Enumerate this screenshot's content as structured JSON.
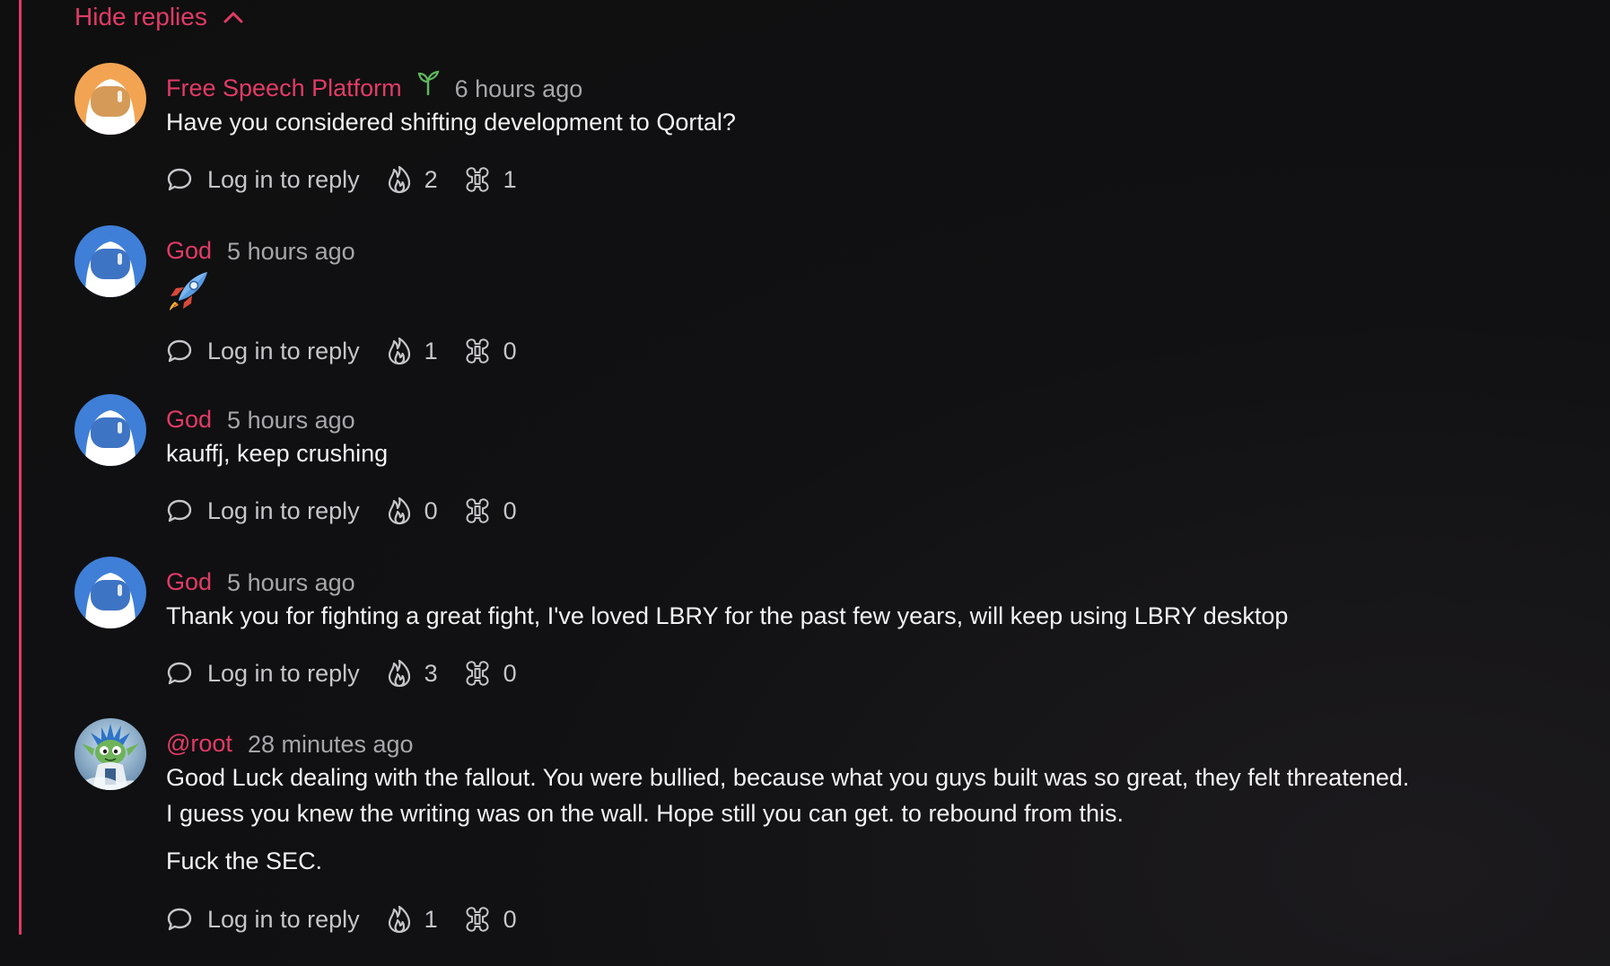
{
  "thread": {
    "hide_replies_label": "Hide replies",
    "accent_color": "#e23b66"
  },
  "comments": [
    {
      "author": "Free Speech Platform",
      "badge_icon": "sprout-icon",
      "time": "6 hours ago",
      "paragraphs": [
        "Have you considered shifting development to Qortal?"
      ],
      "reply_label": "Log in to reply",
      "fire_count": "2",
      "slime_count": "1",
      "avatar": "orange-spaceman-avatar"
    },
    {
      "author": "God",
      "time": "5 hours ago",
      "paragraphs": [],
      "emoji": "rocket-emoji",
      "reply_label": "Log in to reply",
      "fire_count": "1",
      "slime_count": "0",
      "avatar": "blue-spaceman-avatar"
    },
    {
      "author": "God",
      "time": "5 hours ago",
      "paragraphs": [
        "kauffj, keep crushing"
      ],
      "reply_label": "Log in to reply",
      "fire_count": "0",
      "slime_count": "0",
      "avatar": "blue-spaceman-avatar"
    },
    {
      "author": "God",
      "time": "5 hours ago",
      "paragraphs": [
        "Thank you for fighting a great fight, I've loved LBRY for the past few years, will keep using LBRY desktop"
      ],
      "reply_label": "Log in to reply",
      "fire_count": "3",
      "slime_count": "0",
      "avatar": "blue-spaceman-avatar"
    },
    {
      "author": "@root",
      "time": "28 minutes ago",
      "paragraphs": [
        "Good Luck dealing with the fallout. You were bullied, because what you guys built was so great, they felt threatened.",
        "I guess you knew the writing was on the wall. Hope still you can get. to rebound from this.",
        "Fuck the SEC."
      ],
      "reply_label": "Log in to reply",
      "fire_count": "1",
      "slime_count": "0",
      "avatar": "creature-avatar"
    }
  ]
}
